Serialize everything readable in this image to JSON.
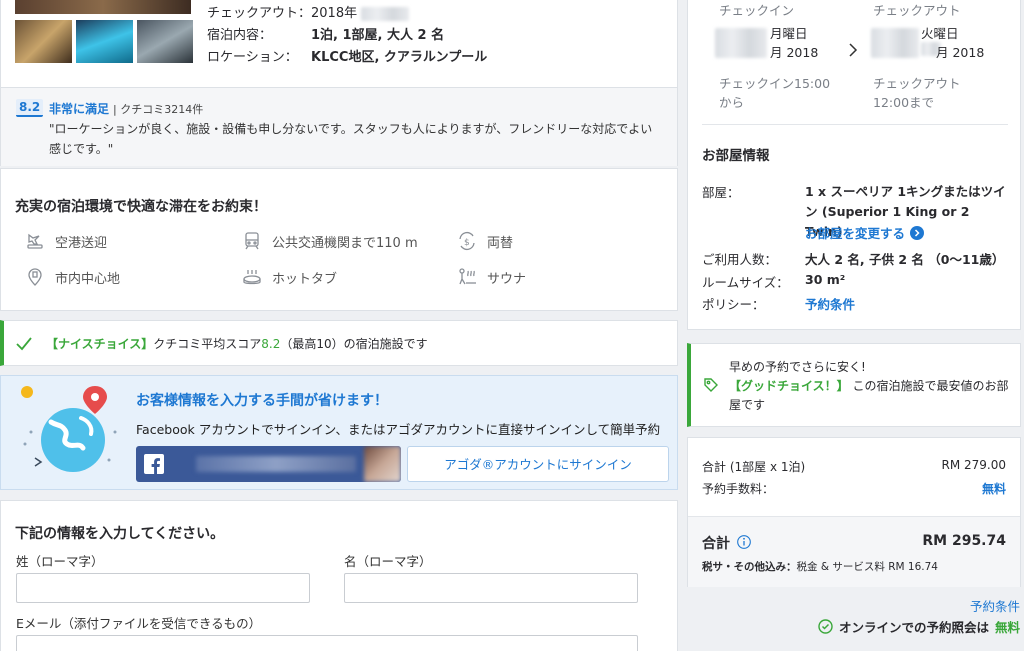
{
  "hotel_summary": {
    "checkout_label": "チェックアウト：",
    "checkout_value": "2018年",
    "stay_label": "宿泊内容：",
    "stay_value": "1泊, 1部屋, 大人 2 名",
    "location_label": "ロケーション：",
    "location_value": "KLCC地区, クアラルンプール"
  },
  "review": {
    "score": "8.2",
    "rating_text": "非常に満足",
    "count_text": " | クチコミ3214件",
    "quote": "\"ローケーションが良く、施設・設備も申し分ないです。スタッフも人によりますが、フレンドリーな対応でよい感じです。\""
  },
  "amenities": {
    "title": "充実の宿泊環境で快適な滞在をお約束！",
    "items": [
      {
        "label": "空港送迎",
        "icon": "airport-shuttle-icon"
      },
      {
        "label": "公共交通機関まで110 m",
        "icon": "public-transport-icon"
      },
      {
        "label": "両替",
        "icon": "currency-exchange-icon"
      },
      {
        "label": "市内中心地",
        "icon": "city-center-icon"
      },
      {
        "label": "ホットタブ",
        "icon": "hot-tub-icon"
      },
      {
        "label": "サウナ",
        "icon": "sauna-icon"
      }
    ]
  },
  "nice_choice": {
    "prefix": "【ナイスチョイス】",
    "text_a": "クチコミ平均スコア",
    "score": "8.2",
    "text_b": "（最高10）の宿泊施設です"
  },
  "signin_promo": {
    "title": "お客様情報を入力する手間が省けます！",
    "description": "Facebook アカウントでサインイン、またはアゴダアカウントに直接サインインして簡単予約",
    "agoda_button": "アゴダ®アカウントにサインイン"
  },
  "form": {
    "title": "下記の情報を入力してください。",
    "last_name_label": "姓（ローマ字）",
    "first_name_label": "名（ローマ字）",
    "email_label": "Eメール（添付ファイルを受信できるもの）"
  },
  "dates": {
    "checkin_header": "チェックイン",
    "checkout_header": "チェックアウト",
    "checkin_weekday": "月曜日",
    "checkin_year": "月 2018",
    "checkout_weekday": "火曜日",
    "checkout_year": "月 2018",
    "checkin_time": "チェックイン15:00",
    "checkin_time_suffix": "から",
    "checkout_time": "チェックアウト",
    "checkout_time_suffix": "12:00まで"
  },
  "room_info": {
    "title": "お部屋情報",
    "room_label": "部屋：",
    "room_value": "1 x スーペリア 1キングまたはツイン (Superior 1 King or 2 Twin)",
    "change_room_link": "お部屋を変更する",
    "guests_label": "ご利用人数：",
    "guests_value": "大人 2 名, 子供 2 名 （0〜11歳）",
    "size_label": "ルームサイズ：",
    "size_value": "30 m²",
    "policy_label": "ポリシー：",
    "policy_link": "予約条件"
  },
  "early_booking": {
    "line1": "早めの予約でさらに安く!",
    "prefix": "【グッドチョイス！】",
    "text": " この宿泊施設で最安値のお部屋です"
  },
  "price": {
    "subtotal_label": "合計 (1部屋 x 1泊)",
    "subtotal_value": "RM 279.00",
    "fee_label": "予約手数料：",
    "fee_value": "無料",
    "total_label": "合計",
    "total_value": "RM 295.74",
    "tax_label": "税サ・その他込み：",
    "tax_value": "税金 & サービス料 RM 16.74"
  },
  "footer": {
    "terms_link": "予約条件",
    "online_text": "オンラインでの予約照会は",
    "online_free": "無料"
  },
  "colors": {
    "accent_blue": "#1e78d2",
    "good_green": "#3aa73a",
    "facebook_blue": "#3b5998"
  }
}
